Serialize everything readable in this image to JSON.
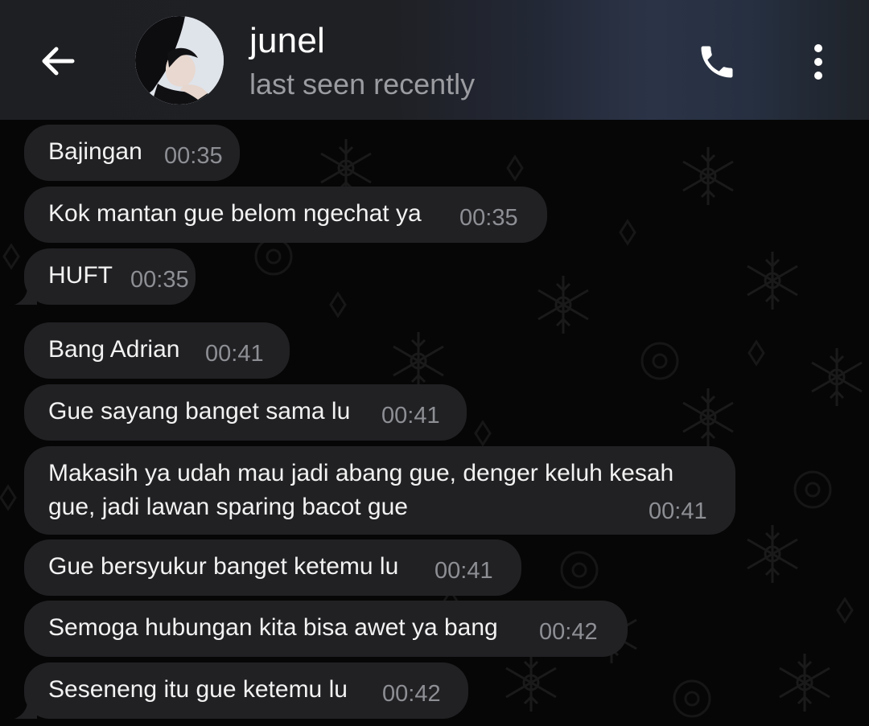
{
  "header": {
    "title": "junel",
    "status": "last seen recently",
    "back_icon": "arrow-left-icon",
    "call_icon": "phone-icon",
    "more_icon": "more-vertical-icon"
  },
  "colors": {
    "bubble": "#212124",
    "text": "#f2f2f2",
    "time": "#8d8f94",
    "background": "#060606"
  },
  "messages": [
    {
      "text": "Bajingan",
      "time": "00:35"
    },
    {
      "text": "Kok mantan gue belom ngechat ya",
      "time": "00:35"
    },
    {
      "text": "HUFT",
      "time": "00:35"
    },
    {
      "text": "Bang Adrian",
      "time": "00:41"
    },
    {
      "text": "Gue sayang banget sama lu",
      "time": "00:41"
    },
    {
      "text": "Makasih ya udah mau jadi abang gue, denger keluh kesah",
      "text_line2": "gue, jadi lawan sparing bacot gue",
      "time": "00:41"
    },
    {
      "text": "Gue bersyukur banget ketemu lu",
      "time": "00:41"
    },
    {
      "text": "Semoga hubungan kita bisa awet ya bang",
      "time": "00:42"
    },
    {
      "text": "Seseneng itu gue ketemu lu",
      "time": "00:42"
    }
  ]
}
